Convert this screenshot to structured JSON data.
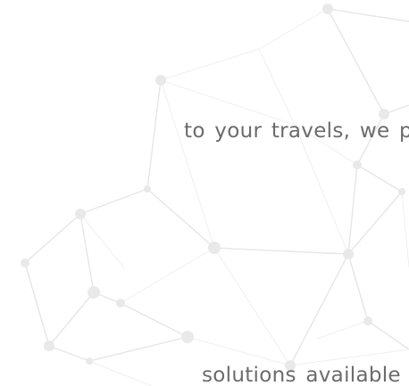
{
  "body_text": {
    "line_1": "to your travels, we pay",
    "line_2": "solutions available on the"
  },
  "background": {
    "pattern": "network-nodes-decoration",
    "color": "#ffffff",
    "line_color": "#e6e6e6",
    "node_color": "#e9e9e9"
  },
  "text_color": "#6b6b6b"
}
